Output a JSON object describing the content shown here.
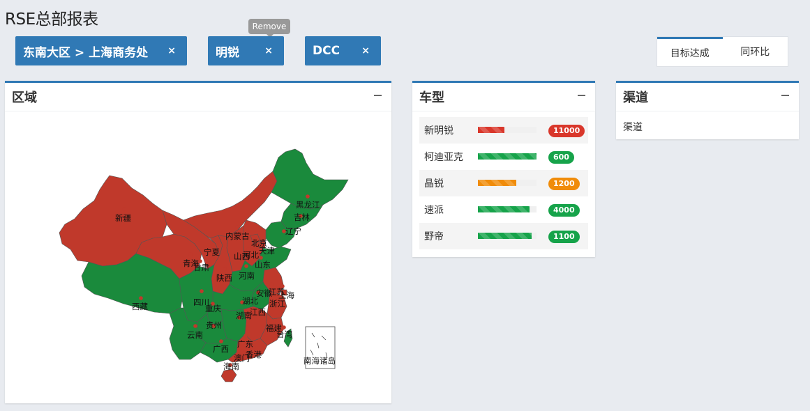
{
  "page": {
    "title": "RSE总部报表"
  },
  "filters": {
    "region": "东南大区 > 上海商务处",
    "model": "明锐",
    "dealer": "DCC",
    "close_glyph": "×",
    "tooltip": "Remove"
  },
  "toggle": {
    "options": [
      "目标达成",
      "同环比"
    ],
    "active": "目标达成"
  },
  "panels": {
    "region": {
      "title": "区域"
    },
    "car": {
      "title": "车型",
      "items": [
        {
          "name": "新明锐",
          "value": "11000",
          "progress": 0.45,
          "color": "#d9372b"
        },
        {
          "name": "柯迪亚克",
          "value": "600",
          "progress": 1.0,
          "color": "#16a34a"
        },
        {
          "name": "晶锐",
          "value": "1200",
          "progress": 0.65,
          "color": "#f08c0a"
        },
        {
          "name": "速派",
          "value": "4000",
          "progress": 0.88,
          "color": "#16a34a"
        },
        {
          "name": "野帝",
          "value": "1100",
          "progress": 0.92,
          "color": "#16a34a"
        }
      ]
    },
    "channel": {
      "title": "渠道",
      "items": [
        "渠道"
      ]
    }
  },
  "map": {
    "labels": {
      "xinjiang": "新疆",
      "xizang": "西藏",
      "qinghai": "青海",
      "gansu": "甘肃",
      "ningxia": "宁夏",
      "neimenggu": "内蒙古",
      "heilongjiang": "黑龙江",
      "jilin": "吉林",
      "liaoning": "辽宁",
      "beijing": "北京",
      "tianjin": "天津",
      "hebei": "河北",
      "shanxi": "山西",
      "shandong": "山东",
      "shaanxi": "陕西",
      "henan": "河南",
      "sichuan": "四川",
      "chongqing": "重庆",
      "hubei": "湖北",
      "anhui": "安徽",
      "jiangsu": "江苏",
      "shanghai": "上海",
      "zhejiang": "浙江",
      "hunan": "湖南",
      "jiangxi": "江西",
      "guizhou": "贵州",
      "yunnan": "云南",
      "guangxi": "广西",
      "guangdong": "广东",
      "fujian": "福建",
      "taiwan": "台湾",
      "hainan": "海南",
      "aomen": "澳门",
      "xianggang": "香港",
      "nanhai": "南海诸岛"
    },
    "colors": {
      "achieved": "#c0392b",
      "not_achieved": "#1a8a3c"
    }
  }
}
